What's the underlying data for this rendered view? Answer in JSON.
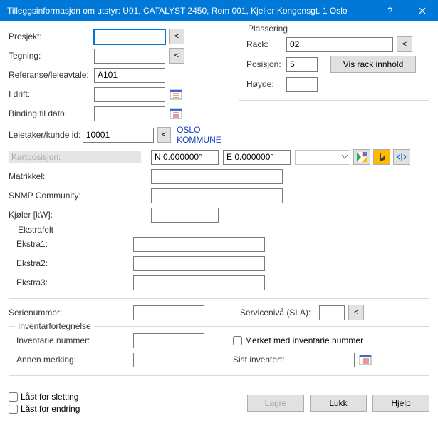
{
  "title": "Tilleggsinformasjon om utstyr: U01, CATALYST 2450, Rom 001, Kjeller Kongensgt. 1 Oslo",
  "labels": {
    "prosjekt": "Prosjekt:",
    "tegning": "Tegning:",
    "referanse": "Referanse/leieavtale:",
    "idrift": "I drift:",
    "binding": "Binding til dato:",
    "leietaker": "Leietaker/kunde id:",
    "kartposisjon": "Kartposisjon:",
    "matrikkel": "Matrikkel:",
    "snmp": "SNMP Community:",
    "kjoler": "Kjøler [kW]:",
    "ekstrafelt": "Ekstrafelt",
    "ekstra1": "Ekstra1:",
    "ekstra2": "Ekstra2:",
    "ekstra3": "Ekstra3:",
    "serienummer": "Serienummer:",
    "serviceniva": "Servicenivå (SLA):",
    "inventar": "Inventarfortegnelse",
    "inventarie": "Inventarie nummer:",
    "merket": "Merket med inventarie nummer",
    "annen": "Annen merking:",
    "sist": "Sist inventert:",
    "plassering": "Plassering",
    "rack": "Rack:",
    "posisjon": "Posisjon:",
    "hoyde": "Høyde:",
    "visrack": "Vis rack innhold",
    "last_sletting": "Låst for sletting",
    "last_endring": "Låst for endring",
    "lagre": "Lagre",
    "lukk": "Lukk",
    "hjelp": "Hjelp",
    "lt": "<"
  },
  "values": {
    "referanse": "A101",
    "leietaker": "10001",
    "leietaker_navn": "OSLO KOMMUNE",
    "coord_n": "N 0.000000°",
    "coord_e": "E 0.000000°",
    "rack": "02",
    "posisjon": "5"
  }
}
